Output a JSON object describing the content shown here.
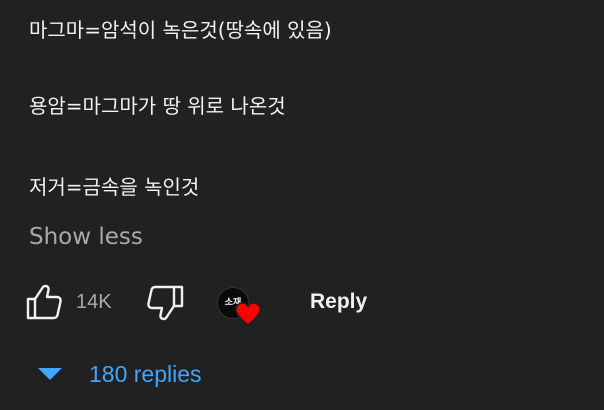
{
  "comment": {
    "lines": [
      "마그마=암석이 녹은것(땅속에 있음)",
      "용암=마그마가 땅 위로 나온것",
      "저거=금속을 녹인것"
    ],
    "show_less_label": "Show less"
  },
  "actions": {
    "like_icon": "thumbs-up-icon",
    "like_count": "14K",
    "dislike_icon": "thumbs-down-icon",
    "creator_avatar_text": "소재",
    "creator_heart_icon": "heart-icon",
    "reply_label": "Reply"
  },
  "replies": {
    "caret_icon": "caret-down-icon",
    "label": "180 replies"
  },
  "colors": {
    "background": "#212121",
    "text": "#f1f1f1",
    "secondary_text": "#aaaaaa",
    "link_blue": "#3ea6ff",
    "heart_red": "#ff0000"
  }
}
